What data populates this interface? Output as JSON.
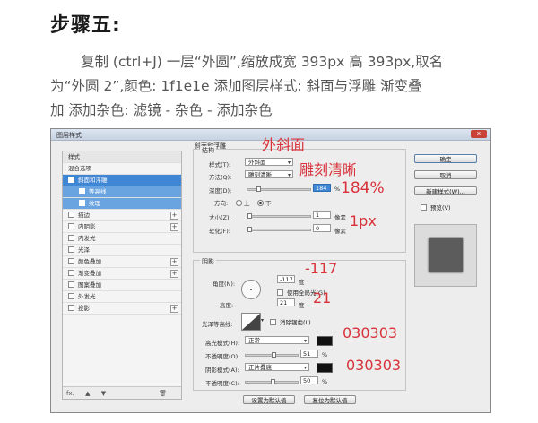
{
  "step_title": "步骤五:",
  "description": {
    "line1": "复制 (ctrl+J) 一层“外圆”,缩放成宽 393px 高 393px,取名",
    "line2": "为“外圆 2”,颜色: 1f1e1e 添加图层样式: 斜面与浮雕 渐变叠",
    "line3": "加 添加杂色: 滤镜 - 杂色 - 添加杂色"
  },
  "dialog": {
    "title": "图层样式",
    "close": "x",
    "style_list": {
      "header": "样式",
      "blend": "混合选项",
      "items": [
        {
          "label": "斜面和浮雕"
        },
        {
          "label": "等高线"
        },
        {
          "label": "纹理"
        },
        {
          "label": "描边"
        },
        {
          "label": "内阴影"
        },
        {
          "label": "内发光"
        },
        {
          "label": "光泽"
        },
        {
          "label": "颜色叠加"
        },
        {
          "label": "渐变叠加"
        },
        {
          "label": "图案叠加"
        },
        {
          "label": "外发光"
        },
        {
          "label": "投影"
        }
      ],
      "footer_fx": "fx."
    },
    "bevel": {
      "group_title": "斜面和浮雕",
      "structure_title": "结构",
      "style_label": "样式(T):",
      "style_value": "外斜面",
      "method_label": "方法(Q):",
      "method_value": "雕刻清晰",
      "depth_label": "深度(D):",
      "depth_value": "184",
      "direction_label": "方向:",
      "dir_up": "上",
      "dir_down": "下",
      "size_label": "大小(Z):",
      "size_value": "1",
      "soften_label": "软化(F):",
      "soften_value": "0",
      "unit_pct": "%",
      "unit_px": "像素"
    },
    "shading": {
      "title": "阴影",
      "angle_label": "角度(N):",
      "angle_value": "-117",
      "angle_unit": "度",
      "global_light": "使用全局光(G)",
      "altitude_label": "高度:",
      "altitude_value": "21",
      "altitude_unit": "度",
      "gloss_label": "光泽等高线:",
      "anti_alias": "消除锯齿(L)",
      "highlight_label": "高光模式(H):",
      "highlight_mode": "正常",
      "highlight_opacity_label": "不透明度(O):",
      "highlight_opacity": "51",
      "shadow_label": "阴影模式(A):",
      "shadow_mode": "正片叠底",
      "shadow_opacity_label": "不透明度(C):",
      "shadow_opacity": "50",
      "unit_pct": "%"
    },
    "buttons": {
      "set_default": "设置为默认值",
      "reset_default": "复位为默认值",
      "ok": "确定",
      "cancel": "取消",
      "new_style": "新建样式(W)...",
      "preview": "预览(V)"
    }
  },
  "annotations": {
    "outer_bevel": "外斜面",
    "chisel_hard": "雕刻清晰",
    "depth": "184%",
    "size": "1px",
    "angle": "-117",
    "altitude": "21",
    "highlight_color": "030303",
    "shadow_color": "030303"
  },
  "colors": {
    "annotation": "#d8323b",
    "selection": "#3f86d4",
    "swatch": "#111111"
  }
}
